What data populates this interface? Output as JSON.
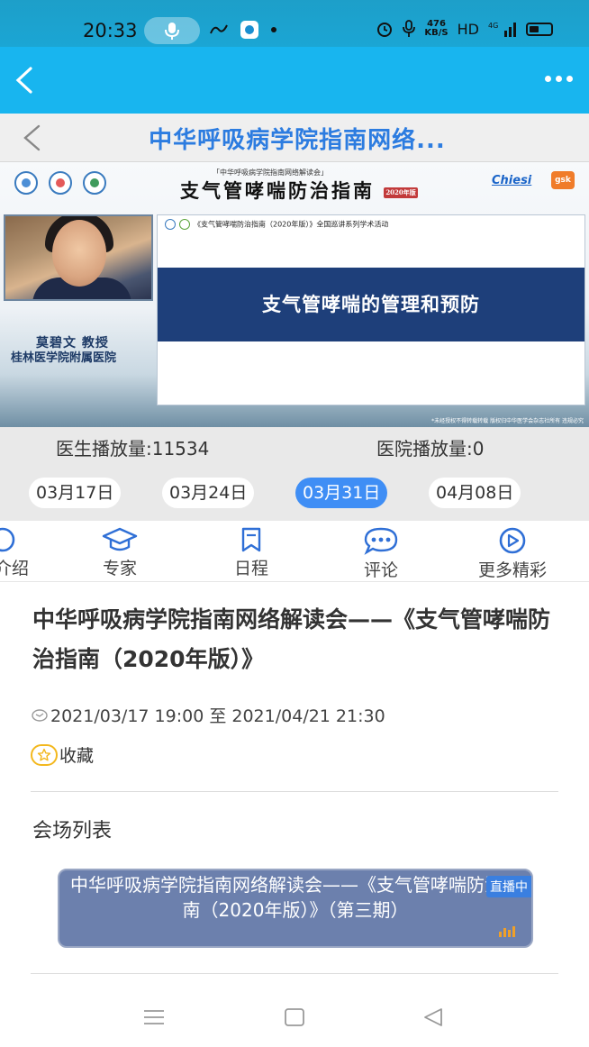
{
  "status_bar": {
    "time": "20:33",
    "speed_value": "476",
    "speed_unit": "KB/S",
    "hd": "HD",
    "network": "4G"
  },
  "page": {
    "title": "中华呼吸病学院指南网络..."
  },
  "video": {
    "banner_subtitle": "「中华呼吸病学院指南网络解读会」",
    "banner_title": "支气管哮喘防治指南",
    "banner_badge": "2020年版",
    "sponsor_1": "Chiesi",
    "sponsor_2": "gsk",
    "speaker_name": "莫碧文 教授",
    "speaker_org": "桂林医学院附属医院",
    "slide_header": "《支气管哮喘防治指南（2020年版）》全国巡讲系列学术活动",
    "slide_title": "支气管哮喘的管理和预防",
    "note": "*未经授权不得转载转载 版权归中华医学会杂志社所有 违规必究"
  },
  "stats": {
    "doctor_plays": "医生播放量:11534",
    "hospital_plays": "医院播放量:0"
  },
  "dates": [
    {
      "label": "03月17日",
      "active": false
    },
    {
      "label": "03月24日",
      "active": false
    },
    {
      "label": "03月31日",
      "active": true
    },
    {
      "label": "04月08日",
      "active": false
    }
  ],
  "tabs": [
    {
      "label": "介绍",
      "icon": "info-icon"
    },
    {
      "label": "专家",
      "icon": "graduation-cap-icon"
    },
    {
      "label": "日程",
      "icon": "bookmark-icon"
    },
    {
      "label": "评论",
      "icon": "chat-bubble-icon"
    },
    {
      "label": "更多精彩",
      "icon": "play-circle-icon"
    }
  ],
  "event": {
    "title": "中华呼吸病学院指南网络解读会——《支气管哮喘防治指南（2020年版）》",
    "time": "2021/03/17 19:00 至 2021/04/21 21:30",
    "favorite_label": "收藏"
  },
  "venues": {
    "heading": "会场列表",
    "items": [
      {
        "title": "中华呼吸病学院指南网络解读会——《支气管哮喘防治指南（2020年版）》（第三期）",
        "badge": "直播中"
      }
    ]
  },
  "colors": {
    "header": "#18b5ef",
    "title_text": "#2c7ce0",
    "active_date": "#3f8ef5",
    "tab_icon": "#2f6fd6",
    "venue_card": "#6c80ad",
    "live_badge": "#3a7fe0",
    "slide_band": "#1e3f7a"
  }
}
